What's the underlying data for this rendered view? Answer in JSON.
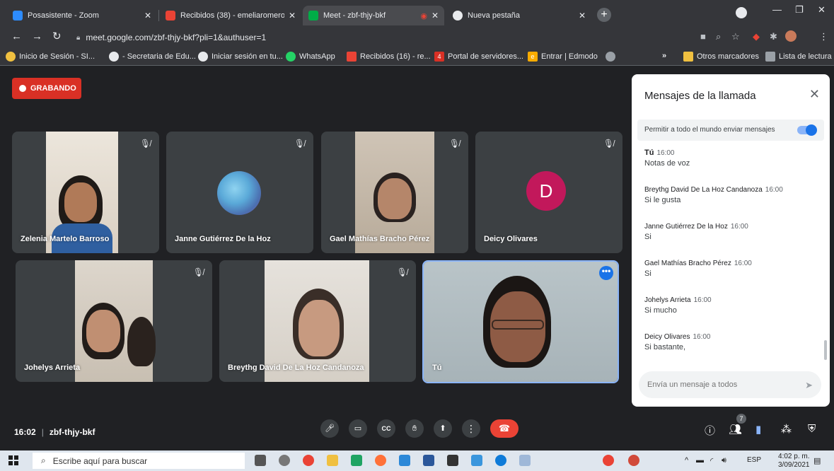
{
  "browser": {
    "tabs": [
      {
        "title": "Posasistente - Zoom",
        "color": "#2d8cff"
      },
      {
        "title": "Recibidos (38) - emeliaromero@",
        "color": "#ea4335"
      },
      {
        "title": "Meet - zbf-thjy-bkf",
        "color": "#00ac47",
        "active": true
      },
      {
        "title": "Nueva pestaña",
        "color": "#e8eaed"
      }
    ],
    "url": "meet.google.com/zbf-thjy-bkf?pli=1&authuser=1",
    "bookmarks": [
      "Inicio de Sesión - SI...",
      "- Secretaria de Edu...",
      "Iniciar sesión en tu...",
      "WhatsApp",
      "Recibidos (16) - re...",
      "Portal de servidores...",
      "Entrar | Edmodo"
    ],
    "more_bookmarks": "»",
    "other_bookmarks": "Otros marcadores",
    "reading_list": "Lista de lectura"
  },
  "meet": {
    "recording_label": "GRABANDO",
    "participants": [
      {
        "name": "Zelenia Martelo Barroso",
        "muted": true
      },
      {
        "name": "Janne Gutiérrez De la Hoz",
        "muted": true
      },
      {
        "name": "Gael Mathías Bracho Pérez",
        "muted": true
      },
      {
        "name": "Deicy Olivares",
        "muted": true,
        "avatar_letter": "D"
      },
      {
        "name": "Johelys Arrieta",
        "muted": true
      },
      {
        "name": "Breythg David De La Hoz Candanoza",
        "muted": true
      },
      {
        "name": "Tú",
        "muted": false
      }
    ],
    "more_options": "•••",
    "time": "16:02",
    "separator": "|",
    "meeting_code": "zbf-thjy-bkf",
    "people_count": "7"
  },
  "chat": {
    "title": "Mensajes de la llamada",
    "allow_label": "Permitir a todo el mundo enviar mensajes",
    "messages": [
      {
        "sender": "Tú",
        "time": "16:00",
        "text": "Notas de voz"
      },
      {
        "sender": "Breythg David De La Hoz Candanoza",
        "time": "16:00",
        "text": "Si le gusta"
      },
      {
        "sender": "Janne Gutiérrez De la Hoz",
        "time": "16:00",
        "text": "Si"
      },
      {
        "sender": "Gael Mathías Bracho Pérez",
        "time": "16:00",
        "text": "Si"
      },
      {
        "sender": "Johelys Arrieta",
        "time": "16:00",
        "text": "Si mucho"
      },
      {
        "sender": "Deicy Olivares",
        "time": "16:00",
        "text": "Si bastante,"
      }
    ],
    "input_placeholder": "Envía un mensaje a todos"
  },
  "taskbar": {
    "search_placeholder": "Escribe aquí para buscar",
    "language": "ESP",
    "clock_time": "4:02 p. m.",
    "clock_date": "3/09/2021"
  },
  "colors": {
    "recording": "#d93025",
    "end_call": "#ea4335",
    "accent": "#1a73e8",
    "avatar": "#c2185b"
  }
}
